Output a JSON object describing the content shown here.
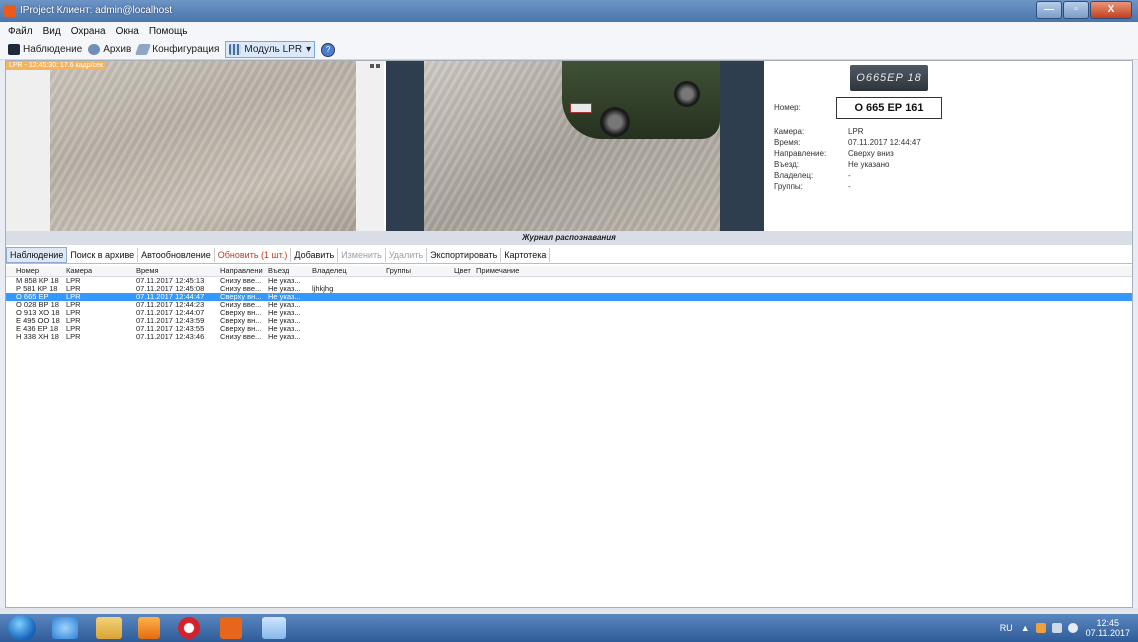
{
  "window": {
    "title": "IProject Клиент: admin@localhost",
    "min_btn": "—",
    "max_btn": "▫",
    "close_btn": "X"
  },
  "menu": [
    "Файл",
    "Вид",
    "Охрана",
    "Окна",
    "Помощь"
  ],
  "toolbar": {
    "observe": "Наблюдение",
    "archive": "Архив",
    "config": "Конфигурация",
    "lpr_module": "Модуль LPR",
    "help_glyph": "?"
  },
  "camera": {
    "overlay": "LPR - 12:45:30; 17.6 кадр/сек"
  },
  "details": {
    "plate_image_text": "O665EP 18",
    "number_label": "Номер:",
    "number_value": "О 665 ЕР 161",
    "fields": [
      {
        "label": "Камера:",
        "value": "LPR"
      },
      {
        "label": "Время:",
        "value": "07.11.2017 12:44:47"
      },
      {
        "label": "Направление:",
        "value": "Сверху вниз"
      },
      {
        "label": "Въезд:",
        "value": "Не указано"
      },
      {
        "label": "Владелец:",
        "value": "-"
      },
      {
        "label": "Группы:",
        "value": "-"
      }
    ]
  },
  "journal": {
    "title": "Журнал распознавания",
    "tabs": [
      {
        "label": "Наблюдение",
        "state": "active"
      },
      {
        "label": "Поиск в архиве",
        "state": "normal"
      },
      {
        "label": "Автообновление",
        "state": "normal"
      },
      {
        "label": "Обновить (1 шт.)",
        "state": "red"
      },
      {
        "label": "Добавить",
        "state": "normal"
      },
      {
        "label": "Изменить",
        "state": "disabled"
      },
      {
        "label": "Удалить",
        "state": "disabled"
      },
      {
        "label": "Экспортировать",
        "state": "normal"
      },
      {
        "label": "Картотека",
        "state": "normal"
      }
    ],
    "columns": [
      "Номер",
      "Камера",
      "Время",
      "Направлени",
      "Въезд",
      "Владелец",
      "Группы",
      "Цвет",
      "Примечание"
    ],
    "rows": [
      [
        "М 858 КР 18",
        "LPR",
        "07.11.2017 12:45:13",
        "Снизу вве...",
        "Не указ...",
        "",
        "",
        "",
        ""
      ],
      [
        "Р 581 КР 18",
        "LPR",
        "07.11.2017 12:45:08",
        "Снизу вве...",
        "Не указ...",
        "ljhkjhg",
        "",
        "",
        ""
      ],
      [
        "О 665 ЕР",
        "LPR",
        "07.11.2017 12:44:47",
        "Сверху вн...",
        "Не указ...",
        "",
        "",
        "",
        ""
      ],
      [
        "О 028 ВР 18",
        "LPR",
        "07.11.2017 12:44:23",
        "Снизу вве...",
        "Не указ...",
        "",
        "",
        "",
        ""
      ],
      [
        "О 913 ХО 18",
        "LPR",
        "07.11.2017 12:44:07",
        "Сверху вн...",
        "Не указ...",
        "",
        "",
        "",
        ""
      ],
      [
        "Е 495 ОО 18",
        "LPR",
        "07.11.2017 12:43:59",
        "Сверху вн...",
        "Не указ...",
        "",
        "",
        "",
        ""
      ],
      [
        "Е 436 ЕР 18",
        "LPR",
        "07.11.2017 12:43:55",
        "Сверху вн...",
        "Не указ...",
        "",
        "",
        "",
        ""
      ],
      [
        "Н 338 ХН 18",
        "LPR",
        "07.11.2017 12:43:46",
        "Снизу вве...",
        "Не указ...",
        "",
        "",
        "",
        ""
      ]
    ],
    "selected_row": 2
  },
  "taskbar": {
    "lang": "RU",
    "tray_up": "▲",
    "time": "12:45",
    "date": "07.11.2017",
    "apps": [
      "ie-icon",
      "explorer-icon",
      "media-player-icon",
      "yandex-browser-icon",
      "iproject-icon",
      "paint-icon"
    ]
  }
}
